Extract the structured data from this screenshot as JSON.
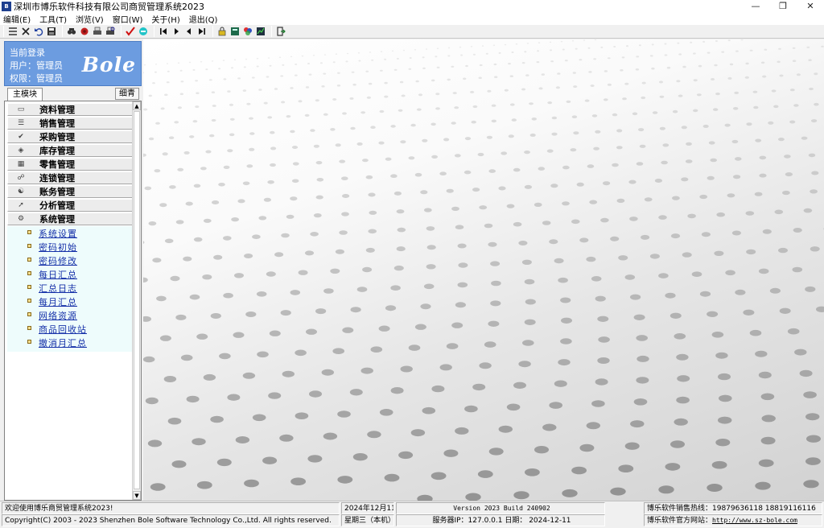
{
  "window": {
    "title": "深圳市博乐软件科技有限公司商贸管理系统2023",
    "icon": "app-icon",
    "controls": [
      "—",
      "❐",
      "✕"
    ]
  },
  "menu": [
    "编辑(E)",
    "工具(T)",
    "浏览(V)",
    "窗口(W)",
    "关于(H)",
    "退出(Q)"
  ],
  "toolbar": {
    "icons": [
      "list-icon",
      "delete-icon",
      "undo-icon",
      "save-icon",
      "find-icon",
      "stamp-icon",
      "print-icon",
      "print-preview-icon",
      "check-icon",
      "refresh-icon",
      "first-icon",
      "prev-icon",
      "next-icon",
      "last-icon",
      "lock-icon",
      "calc-icon",
      "color-icon",
      "chart-icon",
      "exit-icon"
    ]
  },
  "login": {
    "heading": "当前登录",
    "user_label": "用户：",
    "user_value": "管理员",
    "role_label": "权限：",
    "role_value": "管理员",
    "logo_text": "Bole",
    "logo_color": "#6c9ce0"
  },
  "tabs": {
    "main": "主模块",
    "button": "细青"
  },
  "modules": [
    {
      "label": "资料管理",
      "icon": "folder-icon"
    },
    {
      "label": "销售管理",
      "icon": "sales-icon"
    },
    {
      "label": "采购管理",
      "icon": "cart-icon"
    },
    {
      "label": "库存管理",
      "icon": "inventory-icon"
    },
    {
      "label": "零售管理",
      "icon": "retail-icon"
    },
    {
      "label": "连锁管理",
      "icon": "chain-icon"
    },
    {
      "label": "账务管理",
      "icon": "account-icon"
    },
    {
      "label": "分析管理",
      "icon": "analysis-icon"
    },
    {
      "label": "系统管理",
      "icon": "system-icon"
    }
  ],
  "system_items": [
    "系统设置",
    "密码初始",
    "密码修改",
    "每日汇总",
    "汇总日志",
    "每月汇总",
    "网络资源",
    "商品回收站",
    "撤消月汇总"
  ],
  "status": {
    "welcome": "欢迎使用博乐商贸管理系统2023!",
    "copyright": "Copyright(C) 2003 - 2023 Shenzhen Bole Software Technology Co.,Ltd. All rights reserved.",
    "date": "2024年12月11日",
    "weekday": "星期三（本机）",
    "version": "Version 2023 Build 240902",
    "server": "服务器IP：127.0.0.1 日期： 2024-12-11",
    "hotline": "博乐软件销售热线：19879636118 18819116116",
    "website_label": "博乐软件官方网站：",
    "website": "http://www.sz-bole.com"
  }
}
